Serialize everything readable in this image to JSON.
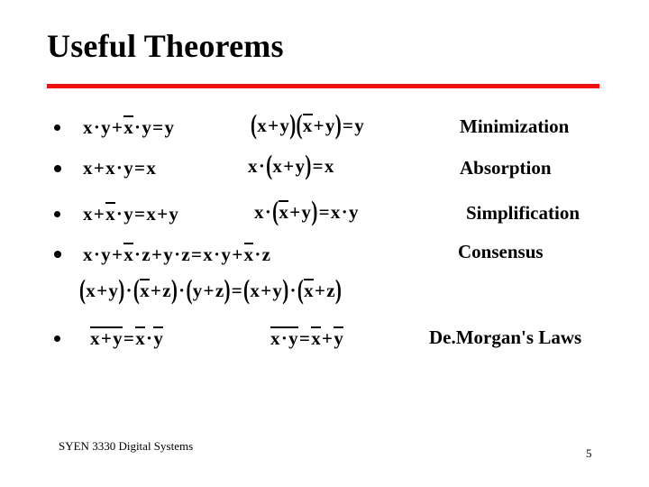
{
  "slide": {
    "title": "Useful Theorems",
    "accent_color": "#ee1111",
    "background_color": "#ffffff",
    "text_color": "#000000"
  },
  "footer": {
    "course": "SYEN 3330 Digital Systems",
    "page_number": "5"
  },
  "theorems": [
    {
      "bullet": "•",
      "name": "Minimization",
      "sum_of_products": "x · y + x̅ · y = y",
      "product_of_sums": "(x + y)(x̅ + y) = y"
    },
    {
      "bullet": "•",
      "name": "Absorption",
      "sum_of_products": "x + x · y = x",
      "product_of_sums": "x · (x + y) = x"
    },
    {
      "bullet": "•",
      "name": "Simplification",
      "sum_of_products": "x + x̅ · y = x + y",
      "product_of_sums": "x · (x̅ + y) = x · y"
    },
    {
      "bullet": "•",
      "name": "Consensus",
      "sum_of_products": "x · y + x̅ · z + y · z = x · y + x̅ · z",
      "product_of_sums": "(x + y) · (x̅ + z) · (y + z) = (x + y) · (x̅ + z)"
    },
    {
      "bullet": "•",
      "name": "De.Morgan's Laws",
      "sum_of_products": "‾‾x + y‾‾ = x̅ · y̅",
      "product_of_sums": "‾‾x · y‾‾ = x̅ + y̅"
    }
  ],
  "glyphs": {
    "dot": "·",
    "plus": "+",
    "equals": "=",
    "lparen": "(",
    "rparen": ")",
    "x": "x",
    "y": "y",
    "z": "z"
  },
  "labels": {
    "minimization": "Minimization",
    "absorption": "Absorption",
    "simplification": "Simplification",
    "consensus": "Consensus",
    "demorgan": "De.Morgan's Laws"
  }
}
